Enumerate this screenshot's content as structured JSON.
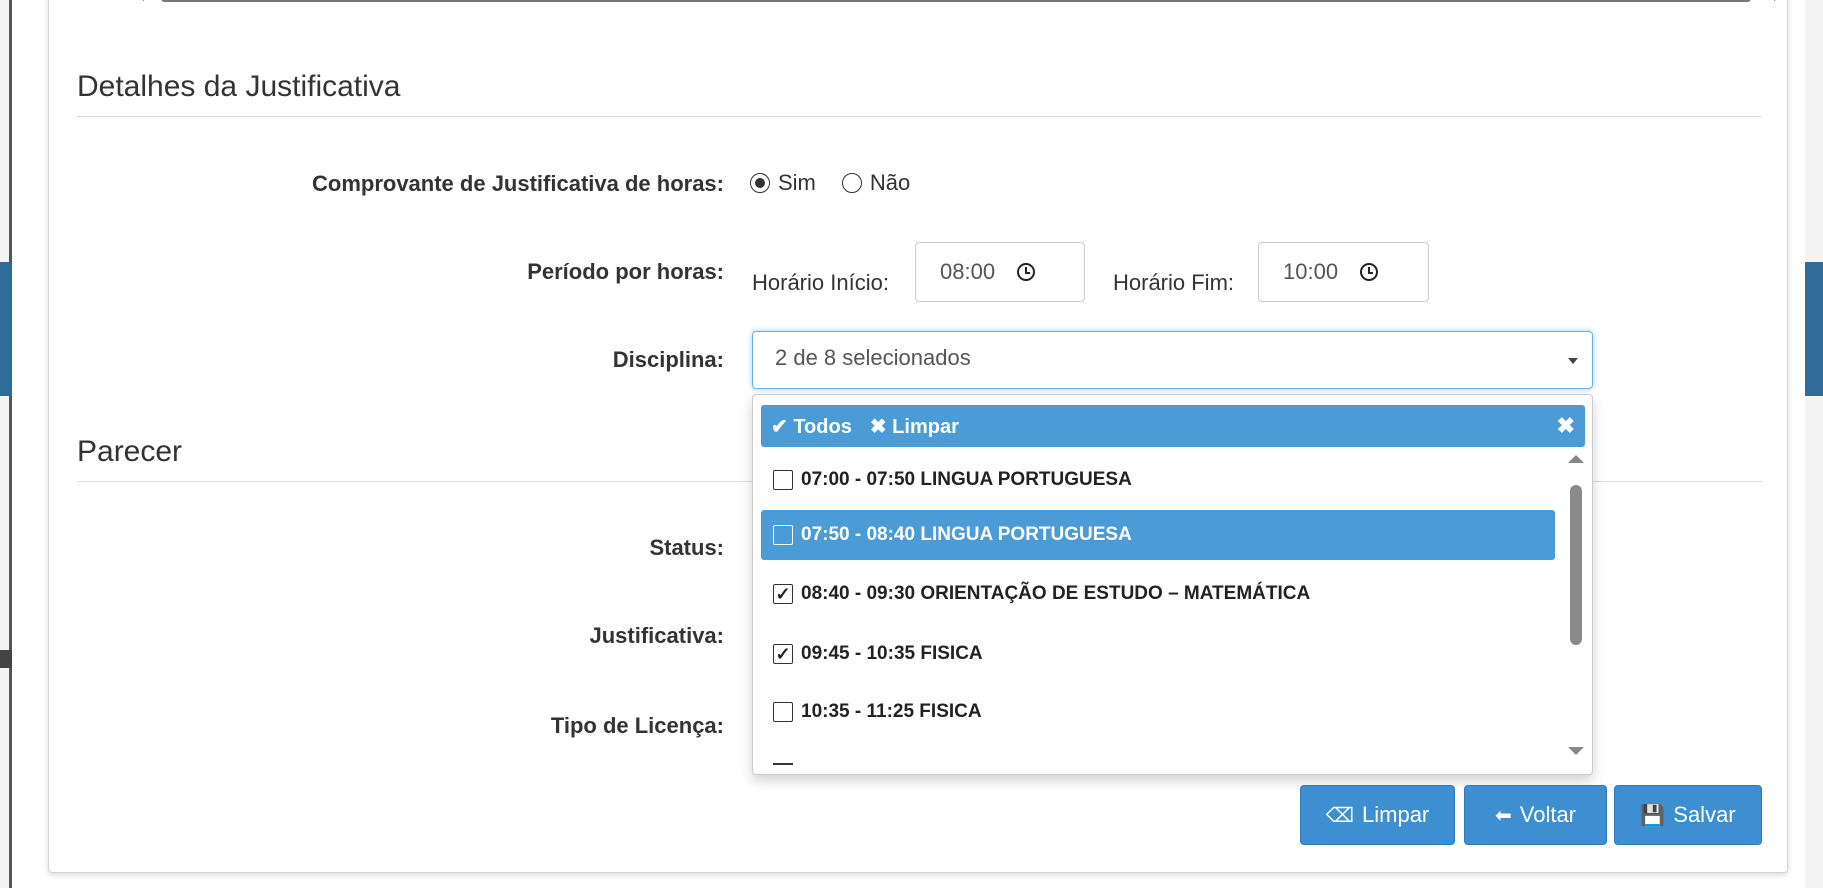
{
  "section_details": {
    "title": "Detalhes da Justificativa"
  },
  "comprovante": {
    "label": "Comprovante de Justificativa de horas:",
    "options": [
      {
        "label": "Sim",
        "checked": true
      },
      {
        "label": "Não",
        "checked": false
      }
    ]
  },
  "periodo": {
    "label": "Período por horas:",
    "inicio_label": "Horário Início:",
    "inicio_value": "08:00",
    "fim_label": "Horário Fim:",
    "fim_value": "10:00"
  },
  "disciplina": {
    "label": "Disciplina:",
    "selected_text": "2 de 8 selecionados",
    "header": {
      "todos": "Todos",
      "limpar": "Limpar"
    },
    "items": [
      {
        "label": "07:00 - 07:50 LINGUA PORTUGUESA",
        "checked": false,
        "active": false
      },
      {
        "label": "07:50 - 08:40 LINGUA PORTUGUESA",
        "checked": false,
        "active": true
      },
      {
        "label": "08:40 - 09:30 ORIENTAÇÃO DE ESTUDO – MATEMÁTICA",
        "checked": true,
        "active": false
      },
      {
        "label": "09:45 - 10:35 FISICA",
        "checked": true,
        "active": false
      },
      {
        "label": "10:35 - 11:25 FISICA",
        "checked": false,
        "active": false
      }
    ]
  },
  "section_parecer": {
    "title": "Parecer"
  },
  "parecer": {
    "status_label": "Status:",
    "justificativa_label": "Justificativa:",
    "tipo_licenca_label": "Tipo de Licença:"
  },
  "buttons": {
    "limpar": "Limpar",
    "voltar": "Voltar",
    "salvar": "Salvar"
  },
  "colors": {
    "primary": "#3d8fd1",
    "dropdown_header": "#4a9bd6",
    "focus_border": "#66afe9"
  }
}
